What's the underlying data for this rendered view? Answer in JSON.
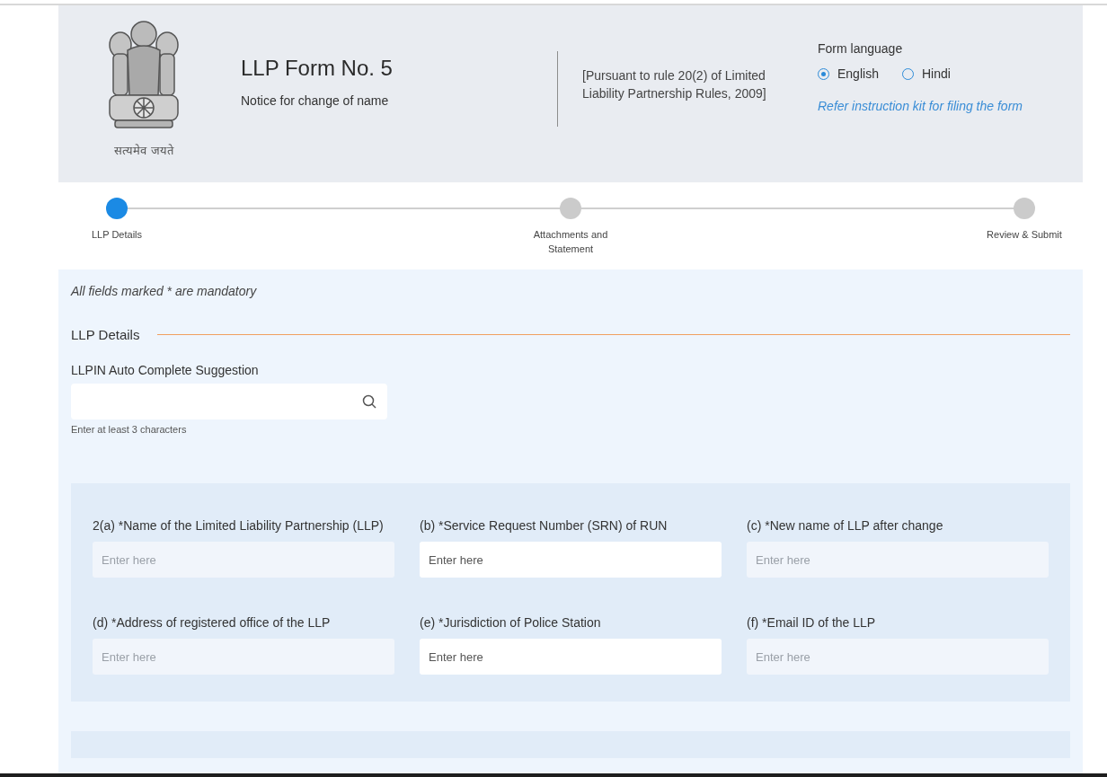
{
  "header": {
    "emblem_motto": "सत्यमेव जयते",
    "title": "LLP Form No. 5",
    "subtitle": "Notice for change of name",
    "pursuant": "[Pursuant to rule 20(2) of Limited Liability Partnership Rules, 2009]",
    "language_label": "Form language",
    "languages": [
      {
        "label": "English",
        "selected": true
      },
      {
        "label": "Hindi",
        "selected": false
      }
    ],
    "instruction_link": "Refer instruction kit for filing the form"
  },
  "steps": [
    {
      "label": "LLP Details",
      "selected": true
    },
    {
      "label": "Attachments and Statement",
      "selected": false
    },
    {
      "label": "Review & Submit",
      "selected": false
    }
  ],
  "mandatory_note": "All fields marked * are mandatory",
  "section_title": "LLP Details",
  "search": {
    "label": "LLPIN Auto Complete Suggestion",
    "hint": "Enter at least 3 characters"
  },
  "fields": [
    {
      "label": "2(a) *Name of the Limited Liability Partnership (LLP)",
      "placeholder": "Enter here",
      "disabled": true
    },
    {
      "label": "(b) *Service Request Number (SRN) of RUN",
      "placeholder": "Enter here",
      "disabled": false
    },
    {
      "label": "(c) *New name of LLP after change",
      "placeholder": "Enter here",
      "disabled": true
    },
    {
      "label": "(d) *Address of registered office of the LLP",
      "placeholder": "Enter here",
      "disabled": true
    },
    {
      "label": "(e) *Jurisdiction of Police Station",
      "placeholder": "Enter here",
      "disabled": false
    },
    {
      "label": "(f) *Email ID of the LLP",
      "placeholder": "Enter here",
      "disabled": true
    }
  ]
}
